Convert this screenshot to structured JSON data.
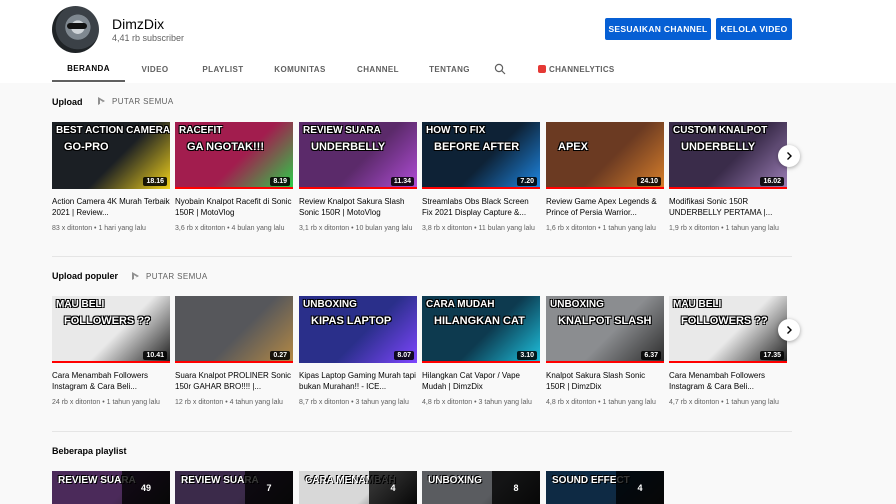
{
  "channel": {
    "name": "DimzDix",
    "subscribers": "4,41 rb subscriber",
    "customize_label": "SESUAIKAN CHANNEL",
    "manage_label": "KELOLA VIDEO"
  },
  "tabs": [
    "BERANDA",
    "VIDEO",
    "PLAYLIST",
    "KOMUNITAS",
    "CHANNEL",
    "TENTANG"
  ],
  "channelytics_label": "CHANNELYTICS",
  "icons": {
    "search": "search-icon",
    "next": "chevron-right-icon",
    "play_all": "play-icon",
    "channelytics": "channelytics-icon"
  },
  "colors": {
    "accent": "#065fd4",
    "progress": "#ff0000"
  },
  "shelves": {
    "upload": {
      "title": "Upload",
      "play_all": "PUTAR SEMUA",
      "videos": [
        {
          "title": "Action Camera 4K Murah Terbaik 2021 | Review...",
          "views": "83 x ditonton",
          "age": "1 hari yang lalu",
          "duration": "18.16",
          "thumb_top": "BEST ACTION CAMERA",
          "thumb_main": "GO-PRO",
          "bg": "#1b1f24",
          "accent": "#f2d21b",
          "progress": 0
        },
        {
          "title": "Nyobain Knalpot Racefit di Sonic 150R | MotoVlog",
          "views": "3,6 rb x ditonton",
          "age": "4 bulan yang lalu",
          "duration": "8.19",
          "thumb_top": "RACEFIT",
          "thumb_main": "GA NGOTAK!!!",
          "bg": "#a21d4e",
          "accent": "#2ad04a",
          "progress": 1.0
        },
        {
          "title": "Review Knalpot Sakura Slash Sonic 150R | MotoVlog",
          "views": "3,1 rb x ditonton",
          "age": "10 bulan yang lalu",
          "duration": "11.34",
          "thumb_top": "REVIEW SUARA",
          "thumb_main": "UNDERBELLY",
          "bg": "#5b2a6a",
          "accent": "#b14dd8",
          "progress": 1.0
        },
        {
          "title": "Streamlabs Obs Black Screen Fix 2021 Display Capture &...",
          "views": "3,8 rb x ditonton",
          "age": "11 bulan yang lalu",
          "duration": "7.20",
          "thumb_top": "HOW TO FIX",
          "thumb_main": "BEFORE  AFTER",
          "bg": "#0e2236",
          "accent": "#1e88e5",
          "progress": 1.0
        },
        {
          "title": "Review Game Apex Legends & Prince of Persia Warrior...",
          "views": "1,6 rb x ditonton",
          "age": "1 tahun yang lalu",
          "duration": "24.10",
          "thumb_top": "",
          "thumb_main": "APEX",
          "bg": "#6b3a22",
          "accent": "#d9802b",
          "progress": 1.0
        },
        {
          "title": "Modifikasi Sonic 150R UNDERBELLY PERTAMA |...",
          "views": "1,9 rb x ditonton",
          "age": "1 tahun yang lalu",
          "duration": "16.02",
          "thumb_top": "CUSTOM KNALPOT",
          "thumb_main": "UNDERBELLY",
          "bg": "#3a2c4a",
          "accent": "#9d7fb8",
          "progress": 1.0
        }
      ]
    },
    "popular": {
      "title": "Upload populer",
      "play_all": "PUTAR SEMUA",
      "videos": [
        {
          "title": "Cara Menambah Followers Instagram & Cara Beli...",
          "views": "24 rb x ditonton",
          "age": "1 tahun yang lalu",
          "duration": "10.41",
          "thumb_top": "MAU BELI",
          "thumb_main": "FOLLOWERS ??",
          "bg": "#e9e9e9",
          "accent": "#1b1b1b",
          "progress": 1.0
        },
        {
          "title": "Suara Knalpot PROLINER Sonic 150r GAHAR BRO!!!! |...",
          "views": "12 rb x ditonton",
          "age": "4 tahun yang lalu",
          "duration": "0.27",
          "thumb_top": "",
          "thumb_main": "",
          "bg": "#56575b",
          "accent": "#b68a44",
          "progress": 1.0
        },
        {
          "title": "Kipas Laptop Gaming Murah tapi bukan Murahan!! - ICE...",
          "views": "8,7 rb x ditonton",
          "age": "3 tahun yang lalu",
          "duration": "8.07",
          "thumb_top": "UNBOXING",
          "thumb_main": "KIPAS LAPTOP",
          "bg": "#2a2f8a",
          "accent": "#7e46ff",
          "progress": 0
        },
        {
          "title": "Hilangkan Cat Vapor / Vape Mudah | DimzDix",
          "views": "4,8 rb x ditonton",
          "age": "3 tahun yang lalu",
          "duration": "3.10",
          "thumb_top": "CARA MUDAH",
          "thumb_main": "HILANGKAN CAT",
          "bg": "#0d3a4f",
          "accent": "#1ec3e0",
          "progress": 1.0
        },
        {
          "title": "Knalpot Sakura Slash Sonic 150R | DimzDix",
          "views": "4,8 rb x ditonton",
          "age": "1 tahun yang lalu",
          "duration": "6.37",
          "thumb_top": "UNBOXING",
          "thumb_main": "KNALPOT SLASH",
          "bg": "#8b8d90",
          "accent": "#2b2b2b",
          "progress": 1.0
        },
        {
          "title": "Cara Menambah Followers Instagram & Cara Beli...",
          "views": "4,7 rb x ditonton",
          "age": "1 tahun yang lalu",
          "duration": "17.35",
          "thumb_top": "MAU BELI",
          "thumb_main": "FOLLOWERS ??",
          "bg": "#e9e9e9",
          "accent": "#1b1b1b",
          "progress": 1.0
        }
      ]
    },
    "playlists": {
      "title": "Beberapa playlist",
      "items": [
        {
          "count": "49",
          "thumb_main": "REVIEW SUARA",
          "bg": "#4b2a5a"
        },
        {
          "count": "7",
          "thumb_main": "REVIEW SUARA",
          "bg": "#3b2a4a"
        },
        {
          "count": "4",
          "thumb_main": "CARA MENAMBAH",
          "bg": "#d8d8d8"
        },
        {
          "count": "8",
          "thumb_main": "UNBOXING",
          "bg": "#5a5c60"
        },
        {
          "count": "4",
          "thumb_main": "SOUND EFFECT",
          "bg": "#0e2a44"
        }
      ]
    }
  }
}
